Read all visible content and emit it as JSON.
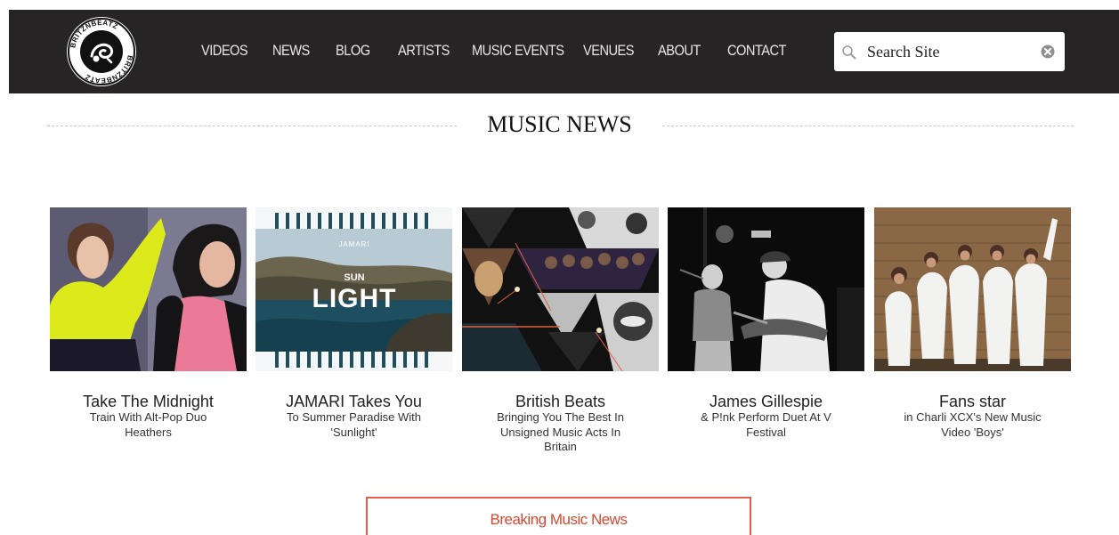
{
  "brand": {
    "logo_text": "BRITZNBEATZ"
  },
  "nav": {
    "items": [
      {
        "label": "VIDEOS"
      },
      {
        "label": "NEWS"
      },
      {
        "label": "BLOG"
      },
      {
        "label": "ARTISTS"
      },
      {
        "label": "MUSIC EVENTS"
      },
      {
        "label": "VENUES"
      },
      {
        "label": "ABOUT"
      },
      {
        "label": "CONTACT"
      }
    ]
  },
  "search": {
    "placeholder": "Search Site",
    "icon": "search-icon",
    "clear_icon": "clear-icon"
  },
  "section": {
    "title": "MUSIC NEWS"
  },
  "articles": [
    {
      "title": "Take The Midnight",
      "subtitle": "Train With Alt-Pop Duo Heathers"
    },
    {
      "title": "JAMARI Takes You",
      "subtitle": "To Summer Paradise With 'Sunlight'",
      "image_text": {
        "artist": "JAMARI",
        "word1": "SUN",
        "word2": "LIGHT"
      }
    },
    {
      "title": "British Beats",
      "subtitle": "Bringing You The Best In Unsigned Music Acts In Britain"
    },
    {
      "title": "James Gillespie",
      "subtitle": "& P!nk Perform Duet At V Festival"
    },
    {
      "title": "Fans star",
      "subtitle": "in Charli XCX's New Music Video 'Boys'"
    }
  ],
  "breaking": {
    "label": "Breaking Music News"
  },
  "colors": {
    "nav_bg": "#272426",
    "accent": "#e0604b"
  }
}
